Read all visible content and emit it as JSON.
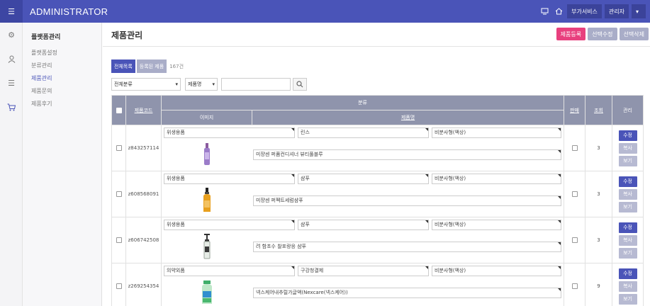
{
  "topbar": {
    "brand": "ADMINISTRATOR",
    "menu_icon": "menu-icon",
    "icons": [
      "monitor-icon",
      "home-icon"
    ],
    "addon_label": "부가서비스",
    "user_label": "관리자",
    "caret": "▾"
  },
  "iconbar": [
    "gear-icon",
    "user-icon",
    "list-icon",
    "cart-icon"
  ],
  "sidenav": {
    "title": "플랫폼관리",
    "items": [
      "플랫폼설정",
      "분류관리",
      "제품관리",
      "제품문의",
      "제품후기"
    ],
    "active_index": 2
  },
  "page": {
    "title": "제품관리",
    "buttons": {
      "register": "제품등록",
      "edit_selected": "선택수정",
      "delete_selected": "선택삭제"
    },
    "tabs": {
      "all": "전체목록",
      "registered": "등록된 제품"
    },
    "count": "167건",
    "filters": {
      "category": "전체분류",
      "field": "제품명",
      "caret": "▾",
      "search_icon": "search-icon"
    }
  },
  "table": {
    "headers": {
      "product_code": "제품코드",
      "category": "분류",
      "image": "이미지",
      "product_name": "제품명",
      "sale": "판매",
      "views": "조회",
      "manage": "관리"
    },
    "row_buttons": {
      "edit": "수정",
      "copy": "복사",
      "view": "보기"
    },
    "rows": [
      {
        "code": "z843257114",
        "cat1": "위생용품",
        "cat2": "린스",
        "cat3": "비분사형(액상)",
        "name": "미쟝센 퍼퓸컨디셔너 뷰티풀블루",
        "views": "3",
        "bottle": "purple"
      },
      {
        "code": "z608568091",
        "cat1": "위생용품",
        "cat2": "샴푸",
        "cat3": "비분사형(액상)",
        "name": "미쟝센 퍼펙트세럼샴푸",
        "views": "3",
        "bottle": "amber"
      },
      {
        "code": "z606742508",
        "cat1": "위생용품",
        "cat2": "샴푸",
        "cat3": "비분사형(액상)",
        "name": "려 함초수 찰포랑응 샴푸",
        "views": "3",
        "bottle": "clear"
      },
      {
        "code": "z269254354",
        "cat1": "의약외품",
        "cat2": "구강청결제",
        "cat3": "비분사형(액상)",
        "name": "넥스케어내추럴가글액(Nexcare(넥스케어))",
        "views": "9",
        "bottle": "green"
      }
    ]
  },
  "colors": {
    "primary": "#4a54b8",
    "accent": "#e8407e",
    "muted": "#a9adc8",
    "header_gray": "#8f94ac"
  }
}
